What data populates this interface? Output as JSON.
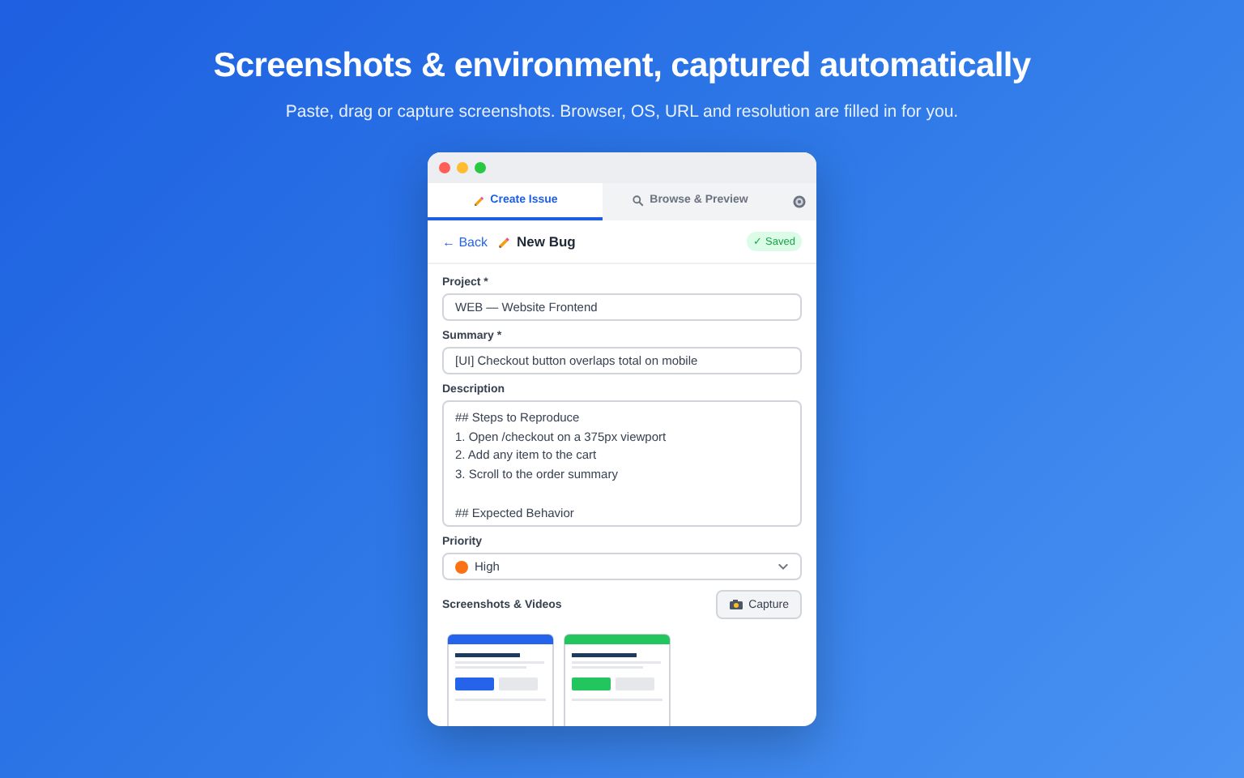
{
  "hero": {
    "title": "Screenshots & environment, captured automatically",
    "subtitle": "Paste, drag or capture screenshots. Browser, OS, URL and resolution are filled in for you."
  },
  "tabs": [
    {
      "kind": "create",
      "label": "Create Issue",
      "selected": true
    },
    {
      "kind": "browse",
      "label": "Browse & Preview",
      "selected": false
    }
  ],
  "header": {
    "back": "← Back",
    "title": "New Bug",
    "status": "✓ Saved"
  },
  "fields": [
    {
      "kind": "input",
      "label": "Project *",
      "value": "WEB — Website Frontend"
    },
    {
      "kind": "input",
      "label": "Summary *",
      "value": "[UI] Checkout button overlaps total on mobile"
    },
    {
      "kind": "textarea",
      "label": "Description",
      "value": "## Steps to Reproduce\n1. Open /checkout on a 375px viewport\n2. Add any item to the cart\n3. Scroll to the order summary\n\n## Expected Behavior"
    },
    {
      "kind": "select",
      "label": "Priority",
      "value": "High",
      "color": "#f97316"
    }
  ],
  "attachments": {
    "label": "Screenshots & Videos",
    "button": "Capture",
    "thumbnails": [
      {
        "color": "#2563eb"
      },
      {
        "color": "#22c55e"
      }
    ]
  }
}
